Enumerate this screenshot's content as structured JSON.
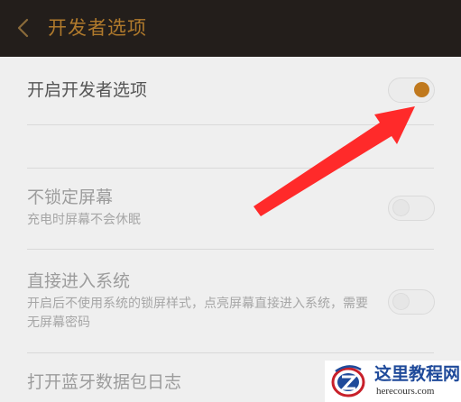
{
  "header": {
    "title": "开发者选项",
    "back_icon": "chevron-left-icon"
  },
  "developer_options": {
    "label": "开启开发者选项",
    "toggle_state": "on"
  },
  "settings": [
    {
      "title": "不锁定屏幕",
      "subtitle": "充电时屏幕不会休眠",
      "toggle_state": "off"
    },
    {
      "title": "直接进入系统",
      "subtitle": "开启后不使用系统的锁屏样式，点亮屏幕直接进入系统，需要无屏幕密码",
      "toggle_state": "off"
    },
    {
      "title": "打开蓝牙数据包日志",
      "subtitle": "",
      "toggle_state": "off"
    }
  ],
  "annotation": {
    "type": "red-arrow",
    "target": "developer-options-toggle"
  },
  "watermark": {
    "logo_icon": "z-logo-icon",
    "name": "这里教程网",
    "url": "herecours.com"
  },
  "colors": {
    "header_bg": "#231e1b",
    "header_title": "#b07a2c",
    "toggle_on": "#c0791e",
    "arrow": "#ff2a2a",
    "watermark_text": "#1f4a9a"
  }
}
